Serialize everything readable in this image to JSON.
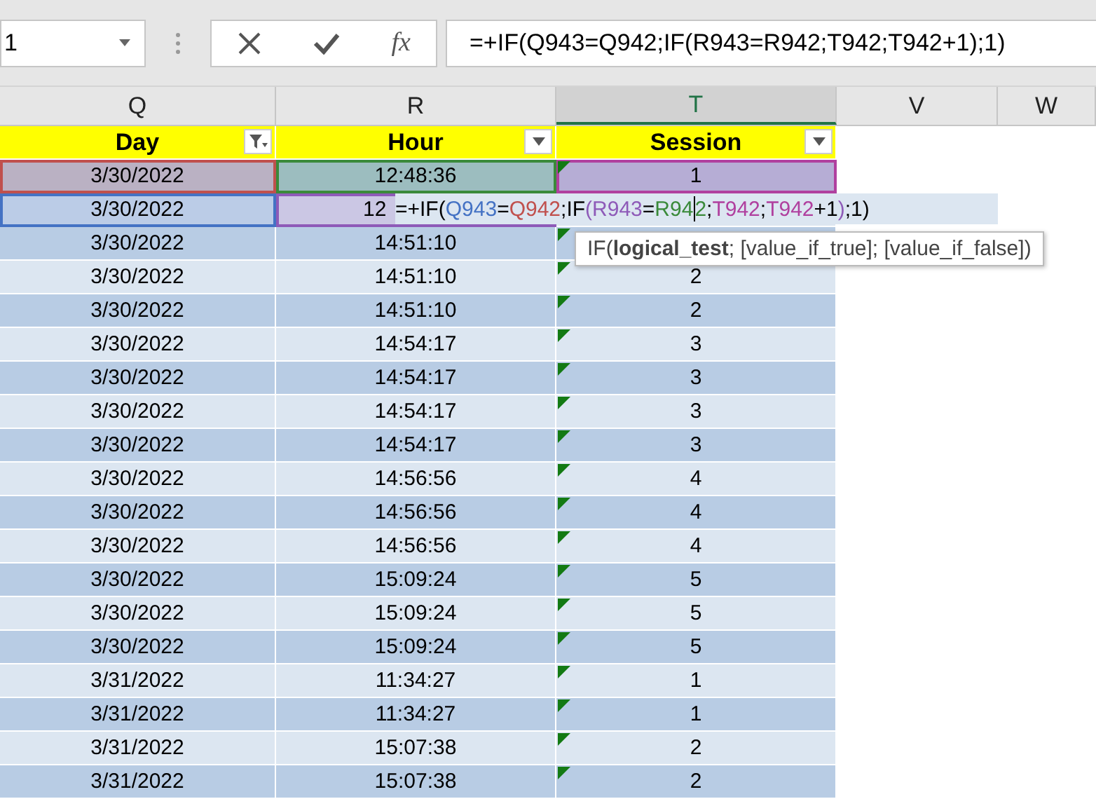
{
  "name_box": {
    "value": "1"
  },
  "function_button": {
    "label": "fx"
  },
  "formula_bar": {
    "value": "=+IF(Q943=Q942;IF(R943=R942;T942;T942+1);1)"
  },
  "column_headers": [
    {
      "label": "Q",
      "selected": false
    },
    {
      "label": "R",
      "selected": false
    },
    {
      "label": "T",
      "selected": true
    },
    {
      "label": "V",
      "selected": false
    },
    {
      "label": "W",
      "selected": false
    }
  ],
  "table_headers": [
    {
      "label": "Day",
      "filtered": true
    },
    {
      "label": "Hour",
      "filtered": false
    },
    {
      "label": "Session",
      "filtered": false
    }
  ],
  "rows": [
    {
      "flag": true,
      "cells": [
        {
          "text": "3/30/2022",
          "color": "#c0504d"
        },
        {
          "text": "12:48:36",
          "color": "#3a8a3a"
        },
        {
          "text": "1",
          "color": "#b0409f"
        }
      ]
    },
    {
      "flag": false,
      "editing": true,
      "cells": [
        {
          "text": "3/30/2022",
          "color": "#4472c4"
        },
        {
          "text": "12",
          "color": "#8e5ab8"
        }
      ]
    },
    {
      "flag": true,
      "cells": [
        {
          "text": "3/30/2022"
        },
        {
          "text": "14:51:10"
        }
      ]
    },
    {
      "flag": true,
      "cells": [
        {
          "text": "3/30/2022"
        },
        {
          "text": "14:51:10"
        },
        {
          "text": "2"
        }
      ]
    },
    {
      "flag": true,
      "cells": [
        {
          "text": "3/30/2022"
        },
        {
          "text": "14:51:10"
        },
        {
          "text": "2"
        }
      ]
    },
    {
      "flag": true,
      "cells": [
        {
          "text": "3/30/2022"
        },
        {
          "text": "14:54:17"
        },
        {
          "text": "3"
        }
      ]
    },
    {
      "flag": true,
      "cells": [
        {
          "text": "3/30/2022"
        },
        {
          "text": "14:54:17"
        },
        {
          "text": "3"
        }
      ]
    },
    {
      "flag": true,
      "cells": [
        {
          "text": "3/30/2022"
        },
        {
          "text": "14:54:17"
        },
        {
          "text": "3"
        }
      ]
    },
    {
      "flag": true,
      "cells": [
        {
          "text": "3/30/2022"
        },
        {
          "text": "14:54:17"
        },
        {
          "text": "3"
        }
      ]
    },
    {
      "flag": true,
      "cells": [
        {
          "text": "3/30/2022"
        },
        {
          "text": "14:56:56"
        },
        {
          "text": "4"
        }
      ]
    },
    {
      "flag": true,
      "cells": [
        {
          "text": "3/30/2022"
        },
        {
          "text": "14:56:56"
        },
        {
          "text": "4"
        }
      ]
    },
    {
      "flag": true,
      "cells": [
        {
          "text": "3/30/2022"
        },
        {
          "text": "14:56:56"
        },
        {
          "text": "4"
        }
      ]
    },
    {
      "flag": true,
      "cells": [
        {
          "text": "3/30/2022"
        },
        {
          "text": "15:09:24"
        },
        {
          "text": "5"
        }
      ]
    },
    {
      "flag": true,
      "cells": [
        {
          "text": "3/30/2022"
        },
        {
          "text": "15:09:24"
        },
        {
          "text": "5"
        }
      ]
    },
    {
      "flag": true,
      "cells": [
        {
          "text": "3/30/2022"
        },
        {
          "text": "15:09:24"
        },
        {
          "text": "5"
        }
      ]
    },
    {
      "flag": true,
      "cells": [
        {
          "text": "3/31/2022"
        },
        {
          "text": "11:34:27"
        },
        {
          "text": "1"
        }
      ]
    },
    {
      "flag": true,
      "cells": [
        {
          "text": "3/31/2022"
        },
        {
          "text": "11:34:27"
        },
        {
          "text": "1"
        }
      ]
    },
    {
      "flag": true,
      "cells": [
        {
          "text": "3/31/2022"
        },
        {
          "text": "15:07:38"
        },
        {
          "text": "2"
        }
      ]
    },
    {
      "flag": true,
      "cells": [
        {
          "text": "3/31/2022"
        },
        {
          "text": "15:07:38"
        },
        {
          "text": "2"
        }
      ]
    }
  ],
  "cell_editor": {
    "tokens": [
      {
        "kind": "text",
        "text": "=+IF(",
        "color": "#000000"
      },
      {
        "kind": "text",
        "text": "Q943",
        "color": "#4472c4"
      },
      {
        "kind": "text",
        "text": "=",
        "color": "#000000"
      },
      {
        "kind": "text",
        "text": "Q942",
        "color": "#c0504d"
      },
      {
        "kind": "text",
        "text": ";IF",
        "color": "#000000"
      },
      {
        "kind": "text",
        "text": "(",
        "color": "#8e5ab8"
      },
      {
        "kind": "text",
        "text": "R943",
        "color": "#8e5ab8"
      },
      {
        "kind": "text",
        "text": "=",
        "color": "#000000"
      },
      {
        "kind": "text",
        "text": "R94",
        "color": "#3a8a3a"
      },
      {
        "kind": "caret"
      },
      {
        "kind": "text",
        "text": "2",
        "color": "#3a8a3a"
      },
      {
        "kind": "text",
        "text": ";",
        "color": "#000000"
      },
      {
        "kind": "text",
        "text": "T942",
        "color": "#b0409f"
      },
      {
        "kind": "text",
        "text": ";",
        "color": "#000000"
      },
      {
        "kind": "text",
        "text": "T942",
        "color": "#b0409f"
      },
      {
        "kind": "text",
        "text": "+1",
        "color": "#000000"
      },
      {
        "kind": "text",
        "text": ")",
        "color": "#8e5ab8"
      },
      {
        "kind": "text",
        "text": ";1)",
        "color": "#000000"
      }
    ]
  },
  "tooltip": {
    "text": "IF(**logical_test**; [value_if_true]; [value_if_false])"
  }
}
